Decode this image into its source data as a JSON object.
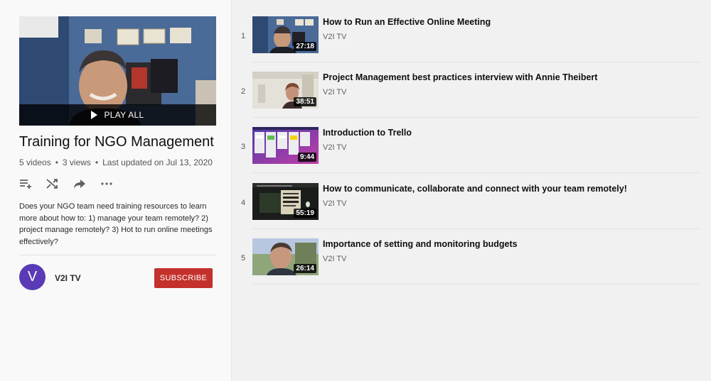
{
  "playlist": {
    "play_all_label": "PLAY ALL",
    "title": "Training for NGO Management",
    "video_count": "5 videos",
    "views": "3 views",
    "updated": "Last updated on Jul 13, 2020",
    "stats_separator": "•",
    "description": "Does your NGO team need training resources to learn more about how to: 1) manage your team remotely? 2) project manage remotely? 3) Hot to run online meetings effectively?",
    "actions": [
      "playlist-add-icon",
      "shuffle-icon",
      "share-icon",
      "more-icon"
    ]
  },
  "owner": {
    "avatar_letter": "V",
    "avatar_color": "#5a3bb5",
    "name": "V2I TV",
    "subscribe_label": "SUBSCRIBE",
    "subscribe_color": "#c4302b"
  },
  "videos": [
    {
      "index": "1",
      "title": "How to Run an Effective Online Meeting",
      "channel": "V2I TV",
      "duration": "27:18"
    },
    {
      "index": "2",
      "title": "Project Management best practices interview with Annie Theibert",
      "channel": "V2I TV",
      "duration": "38:51"
    },
    {
      "index": "3",
      "title": "Introduction to Trello",
      "channel": "V2I TV",
      "duration": "9:44"
    },
    {
      "index": "4",
      "title": "How to communicate, collaborate and connect with your team remotely!",
      "channel": "V2I TV",
      "duration": "55:19"
    },
    {
      "index": "5",
      "title": "Importance of setting and monitoring budgets",
      "channel": "V2I TV",
      "duration": "26:14"
    }
  ]
}
